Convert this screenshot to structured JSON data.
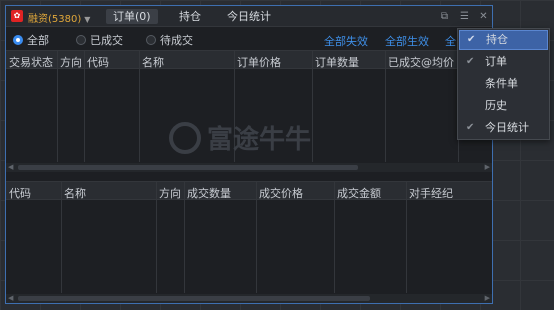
{
  "window": {
    "logo_glyph": "✿",
    "account_label": "融资(5380)",
    "tabs": [
      {
        "label": "订单(0)",
        "active": true
      },
      {
        "label": "持仓",
        "active": false
      },
      {
        "label": "今日统计",
        "active": false
      }
    ],
    "icons": {
      "copy": "⧉",
      "settings": "☰",
      "close": "✕"
    }
  },
  "filters": {
    "options": [
      {
        "label": "全部",
        "selected": true
      },
      {
        "label": "已成交",
        "selected": false
      },
      {
        "label": "待成交",
        "selected": false
      }
    ],
    "actions": [
      "全部失效",
      "全部生效",
      "全"
    ]
  },
  "orders_table": {
    "columns": [
      "交易状态",
      "方向",
      "代码",
      "名称",
      "订单价格",
      "订单数量",
      "已成交@均价"
    ]
  },
  "deals_table": {
    "columns": [
      "代码",
      "名称",
      "方向",
      "成交数量",
      "成交价格",
      "成交金额",
      "对手经纪"
    ]
  },
  "watermark": {
    "text": "富途牛牛"
  },
  "context_menu": {
    "items": [
      {
        "label": "持仓",
        "checked": true,
        "highlighted": true
      },
      {
        "label": "订单",
        "checked": true,
        "highlighted": false
      },
      {
        "label": "条件单",
        "checked": false,
        "highlighted": false
      },
      {
        "label": "历史",
        "checked": false,
        "highlighted": false
      },
      {
        "label": "今日统计",
        "checked": true,
        "highlighted": false
      }
    ]
  },
  "colors": {
    "accent": "#3a8cf0",
    "link": "#3e8fe8",
    "account": "#e0a73a",
    "menu_highlight": "#3d63a6"
  }
}
